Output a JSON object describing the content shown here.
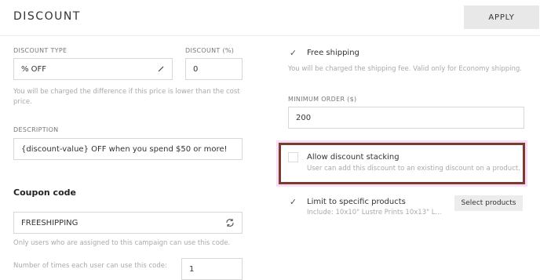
{
  "header": {
    "title": "DISCOUNT",
    "apply_label": "APPLY"
  },
  "left": {
    "discount_type": {
      "label": "DISCOUNT TYPE",
      "value": "% OFF"
    },
    "discount_percent": {
      "label": "DISCOUNT (%)",
      "value": "0"
    },
    "price_help": "You will be charged the difference if this price is lower than the cost price.",
    "description": {
      "label": "DESCRIPTION",
      "value": "{discount-value} OFF when you spend $50 or more!"
    },
    "coupon": {
      "title": "Coupon code",
      "value": "FREESHIPPING",
      "help": "Only users who are assigned to this campaign can use this code."
    },
    "times_per_user": {
      "label": "Number of times each user can use this code:",
      "value": "1"
    }
  },
  "right": {
    "free_shipping": {
      "label": "Free shipping",
      "checked": true,
      "help": "You will be charged the shipping fee. Valid only for Economy shipping."
    },
    "minimum_order": {
      "label": "MINIMUM ORDER ($)",
      "value": "200"
    },
    "stacking": {
      "label": "Allow discount stacking",
      "checked": false,
      "help": "User can add this discount to an existing discount on a product."
    },
    "specific_products": {
      "label": "Limit to specific products",
      "checked": true,
      "include_text": "Include: 10x10\" Lustre Prints 10x13\" L...",
      "button_label": "Select products"
    }
  },
  "icons": {
    "checkmark": "✓",
    "dropdown": "pencil-chevron-icon",
    "refresh": "refresh-icon"
  },
  "colors": {
    "highlight_border": "#7b3b2e",
    "highlight_glow": "#f8dff5"
  }
}
